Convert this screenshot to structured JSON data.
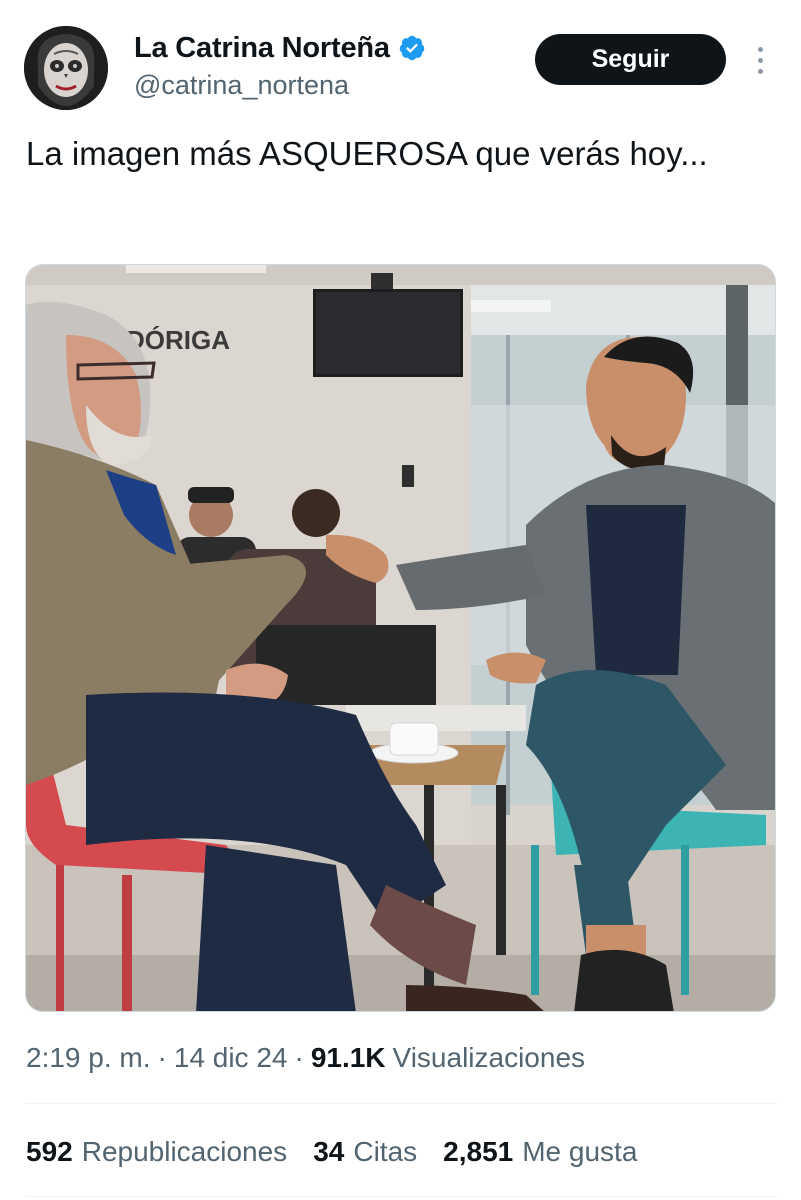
{
  "user": {
    "display_name": "La Catrina Norteña",
    "handle": "@catrina_nortena",
    "verified_icon": "verified-badge-icon"
  },
  "actions": {
    "follow_label": "Seguir",
    "more_icon": "more-vertical-icon"
  },
  "tweet": {
    "text": "La imagen más ASQUEROSA que verás hoy...",
    "media": {
      "sign_text": "DÓRIGA"
    }
  },
  "meta": {
    "time": "2:19 p. m.",
    "separator": "·",
    "date": "14 dic 24",
    "views_count": "91.1K",
    "views_label": "Visualizaciones"
  },
  "stats": [
    {
      "count": "592",
      "label": "Republicaciones"
    },
    {
      "count": "34",
      "label": "Citas"
    },
    {
      "count": "2,851",
      "label": "Me gusta"
    }
  ],
  "colors": {
    "text_primary": "#0f1419",
    "text_secondary": "#536471",
    "verified_blue": "#1d9bf0",
    "button_dark": "#0f1419"
  }
}
